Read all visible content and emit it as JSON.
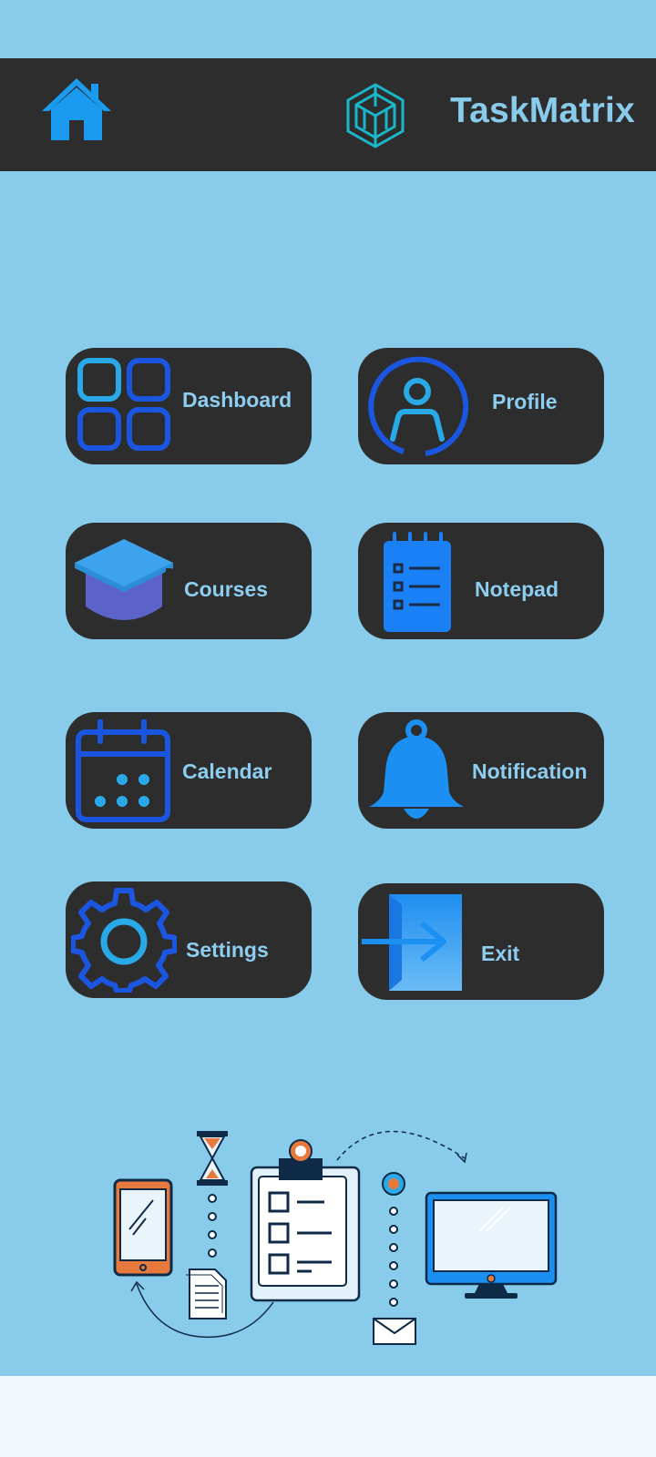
{
  "header": {
    "title": "TaskMatrix",
    "home_icon": "home-icon",
    "logo_icon": "cube-logo-icon"
  },
  "menu": {
    "dashboard": {
      "label": "Dashboard",
      "icon": "grid-icon"
    },
    "profile": {
      "label": "Profile",
      "icon": "user-circle-icon"
    },
    "courses": {
      "label": "Courses",
      "icon": "graduation-cap-icon"
    },
    "notepad": {
      "label": "Notepad",
      "icon": "notepad-icon"
    },
    "calendar": {
      "label": "Calendar",
      "icon": "calendar-icon"
    },
    "notification": {
      "label": "Notification",
      "icon": "bell-icon"
    },
    "settings": {
      "label": "Settings",
      "icon": "gear-icon"
    },
    "exit": {
      "label": "Exit",
      "icon": "exit-door-icon"
    }
  },
  "colors": {
    "background": "#88cbea",
    "bar": "#2d2d2d",
    "label": "#8ccdf0",
    "icon_blue": "#1a56e0",
    "icon_light_blue": "#2aa9e8",
    "footer": "#f1f8fc"
  }
}
